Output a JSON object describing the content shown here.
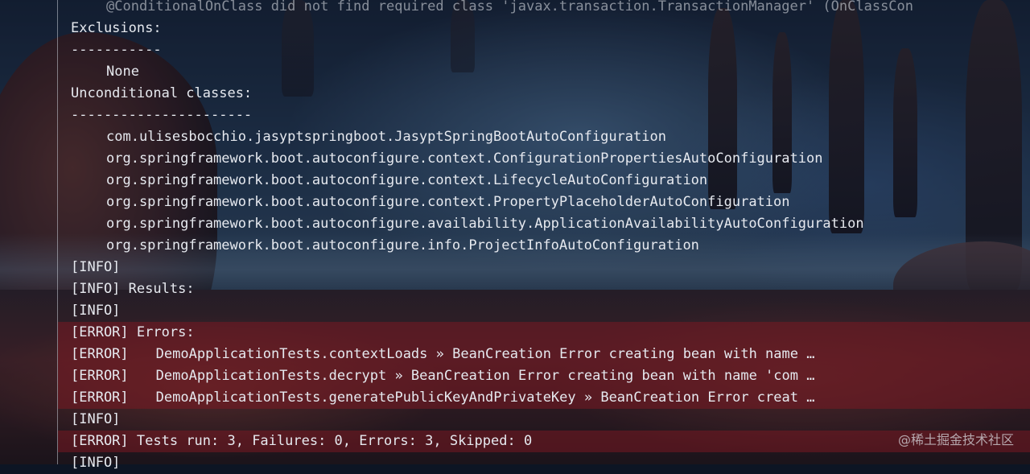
{
  "terminal": {
    "partial_top": "@ConditionalOnClass did not find required class 'javax.transaction.TransactionManager' (OnClassCon",
    "exclusions_header": "Exclusions:",
    "exclusions_rule": "-----------",
    "exclusions_value": "None",
    "unconditional_header": "Unconditional classes:",
    "unconditional_rule": "----------------------",
    "unconditional_classes": [
      "com.ulisesbocchio.jasyptspringboot.JasyptSpringBootAutoConfiguration",
      "org.springframework.boot.autoconfigure.context.ConfigurationPropertiesAutoConfiguration",
      "org.springframework.boot.autoconfigure.context.LifecycleAutoConfiguration",
      "org.springframework.boot.autoconfigure.context.PropertyPlaceholderAutoConfiguration",
      "org.springframework.boot.autoconfigure.availability.ApplicationAvailabilityAutoConfiguration",
      "org.springframework.boot.autoconfigure.info.ProjectInfoAutoConfiguration"
    ],
    "info_tag": "[INFO]",
    "error_tag": "[ERROR]",
    "results_text": "Results:",
    "errors_text": "Errors:",
    "errors": [
      "DemoApplicationTests.contextLoads » BeanCreation Error creating bean with name …",
      "DemoApplicationTests.decrypt » BeanCreation Error creating bean with name 'com …",
      "DemoApplicationTests.generatePublicKeyAndPrivateKey » BeanCreation Error creat …"
    ],
    "summary": "Tests run: 3, Failures: 0, Errors: 3, Skipped: 0"
  },
  "watermark": "@稀土掘金技术社区",
  "colors": {
    "text": "#e6e9ef",
    "error_highlight": "#80182280"
  }
}
